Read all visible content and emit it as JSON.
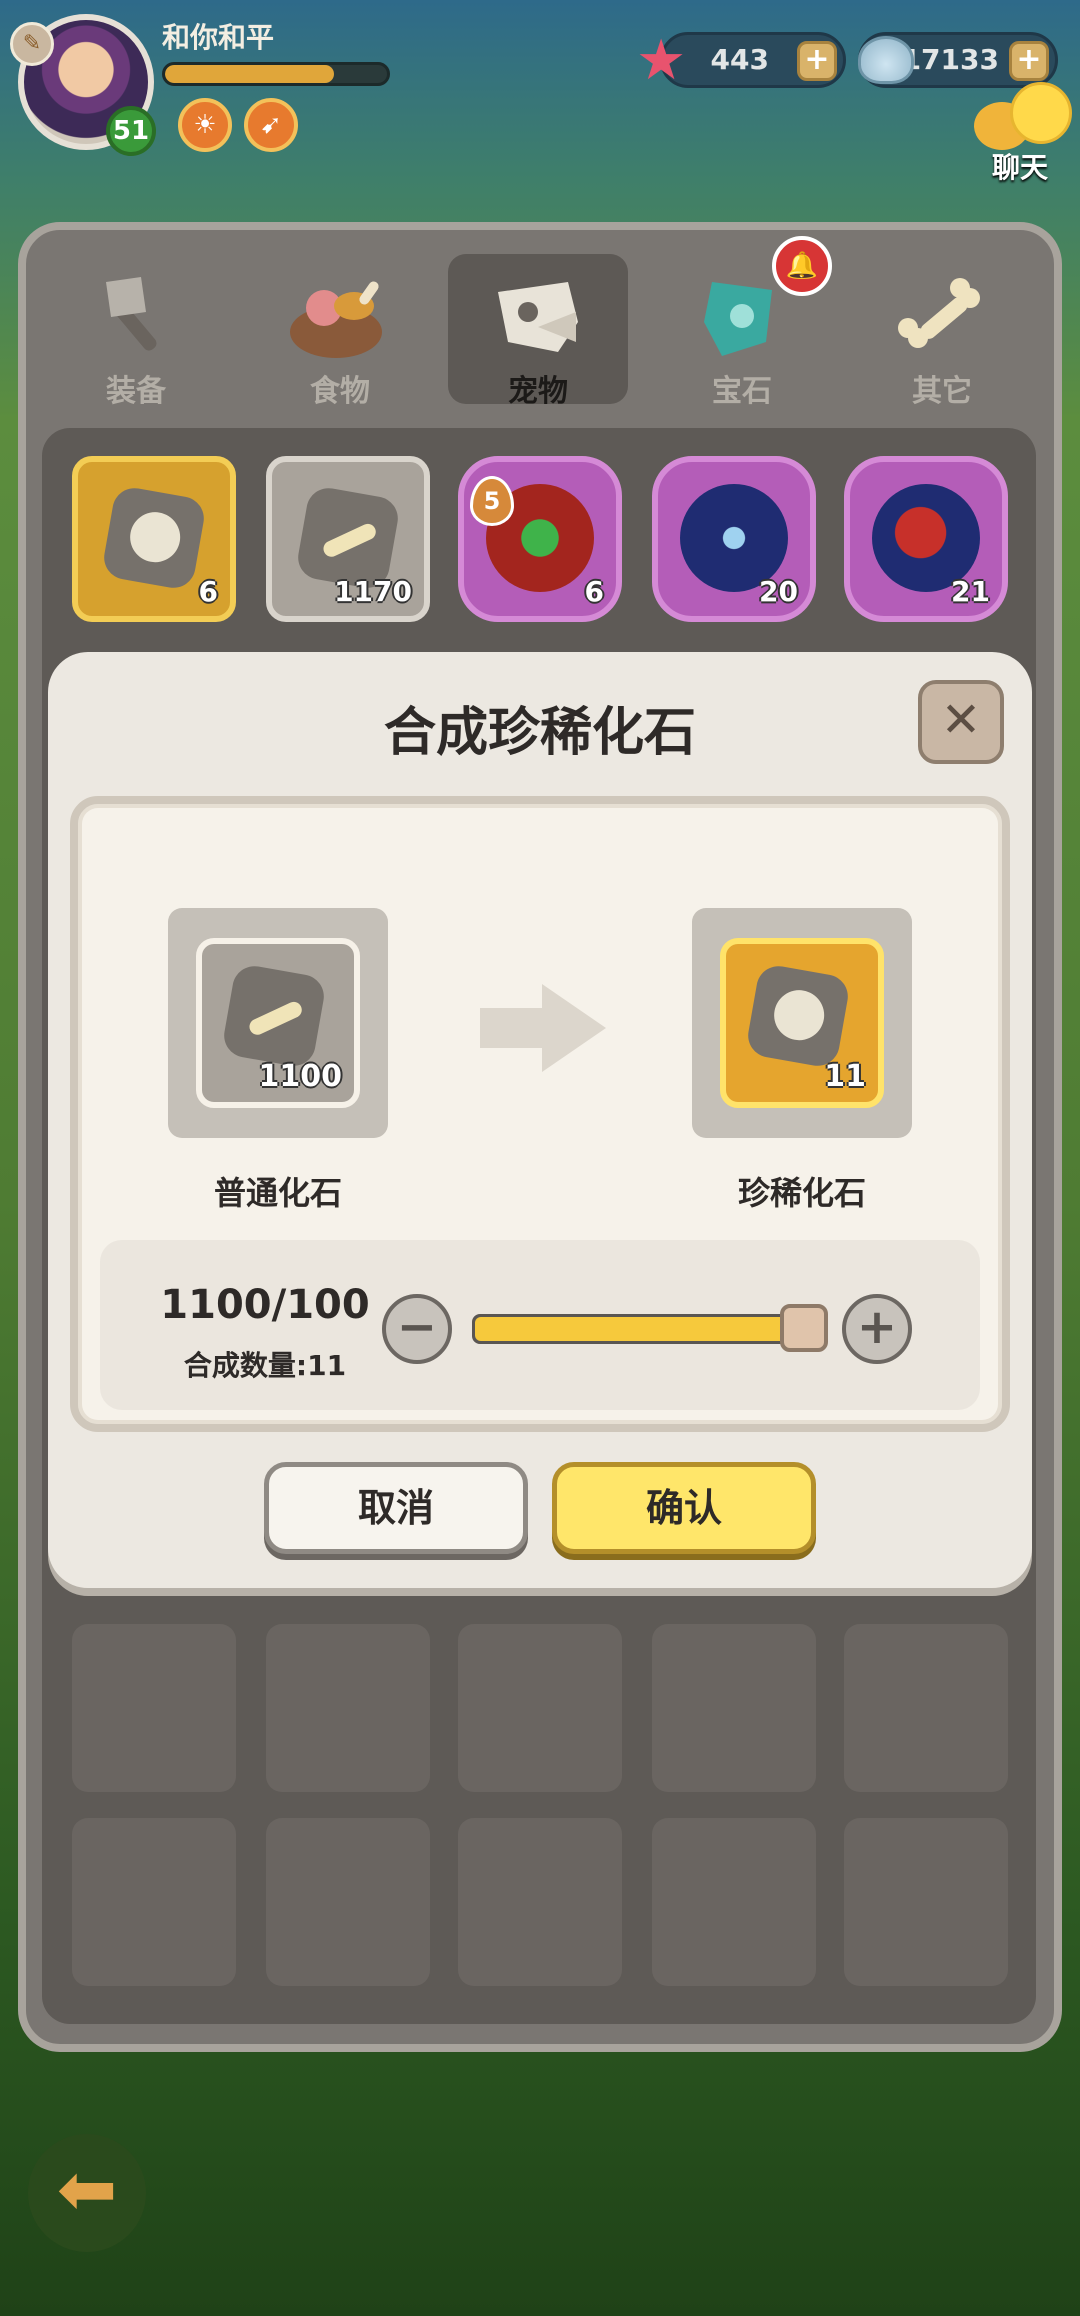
{
  "player": {
    "name": "和你和平",
    "level": "51",
    "exp_fraction": 0.76
  },
  "currencies": [
    {
      "icon": "starfish-icon",
      "value": "443"
    },
    {
      "icon": "shell-icon",
      "value": "117133"
    }
  ],
  "chat": {
    "label": "聊天"
  },
  "tabs": [
    {
      "label": "装备",
      "icon": "axe-icon"
    },
    {
      "label": "食物",
      "icon": "food-bowl-icon"
    },
    {
      "label": "宠物",
      "icon": "pet-skull-icon",
      "active": true
    },
    {
      "label": "宝石",
      "icon": "gem-icon"
    },
    {
      "label": "其它",
      "icon": "bone-icon"
    }
  ],
  "inventory": [
    {
      "name": "rare-fossil",
      "count": "6"
    },
    {
      "name": "common-fossil",
      "count": "1170"
    },
    {
      "name": "heal-orb",
      "count": "6",
      "badge": "5"
    },
    {
      "name": "claw-orb",
      "count": "20"
    },
    {
      "name": "heart-claw-orb",
      "count": "21"
    }
  ],
  "dialog": {
    "title": "合成珍稀化石",
    "source": {
      "name": "普通化石",
      "count": "1100"
    },
    "target": {
      "name": "珍稀化石",
      "count": "11"
    },
    "ratio": "1100/100",
    "quantity_label": "合成数量:11",
    "slider_fraction": 1.0,
    "cancel_label": "取消",
    "confirm_label": "确认"
  },
  "colors": {
    "accent": "#ffe66a",
    "panel": "#7a7672",
    "dialog": "#ece8e1"
  }
}
